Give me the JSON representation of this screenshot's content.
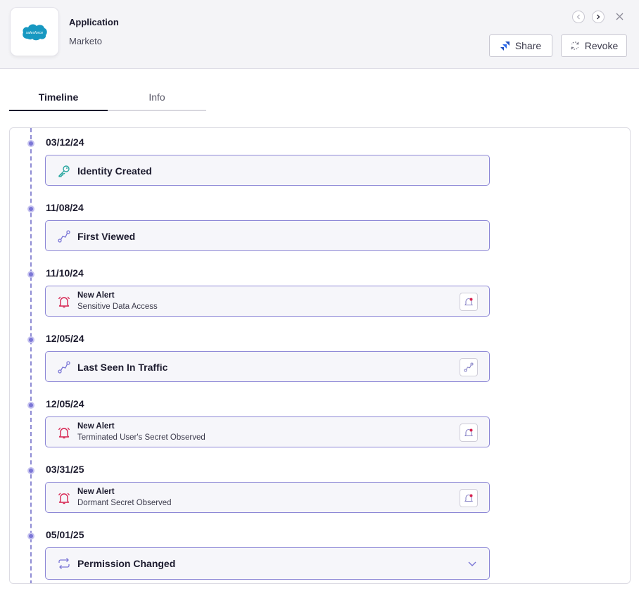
{
  "header": {
    "app_label": "Application",
    "app_name": "Marketo",
    "logo_text": "salesforce",
    "share_label": "Share",
    "revoke_label": "Revoke"
  },
  "tabs": [
    {
      "label": "Timeline",
      "active": true
    },
    {
      "label": "Info",
      "active": false
    }
  ],
  "timeline": [
    {
      "date": "03/12/24",
      "kind": "event",
      "title": "Identity Created",
      "icon": "key-icon"
    },
    {
      "date": "11/08/24",
      "kind": "event",
      "title": "First Viewed",
      "icon": "traffic-path-icon"
    },
    {
      "date": "11/10/24",
      "kind": "alert",
      "title": "New Alert",
      "subtitle": "Sensitive Data Access",
      "icon": "alert-bell-icon",
      "badge": "alert-bell-icon"
    },
    {
      "date": "12/05/24",
      "kind": "event",
      "title": "Last Seen In Traffic",
      "icon": "traffic-path-icon",
      "badge": "traffic-path-icon"
    },
    {
      "date": "12/05/24",
      "kind": "alert",
      "title": "New Alert",
      "subtitle": "Terminated User's Secret Observed",
      "icon": "alert-bell-icon",
      "badge": "alert-bell-icon"
    },
    {
      "date": "03/31/25",
      "kind": "alert",
      "title": "New Alert",
      "subtitle": "Dormant Secret Observed",
      "icon": "alert-bell-icon",
      "badge": "alert-bell-icon"
    },
    {
      "date": "05/01/25",
      "kind": "event",
      "title": "Permission Changed",
      "icon": "refresh-icon",
      "expandable": true
    }
  ],
  "colors": {
    "accent": "#7b76d6",
    "card_border": "#8d88d6",
    "alert": "#d6204e",
    "key": "#2aa7a0",
    "salesforce": "#1798c1"
  }
}
